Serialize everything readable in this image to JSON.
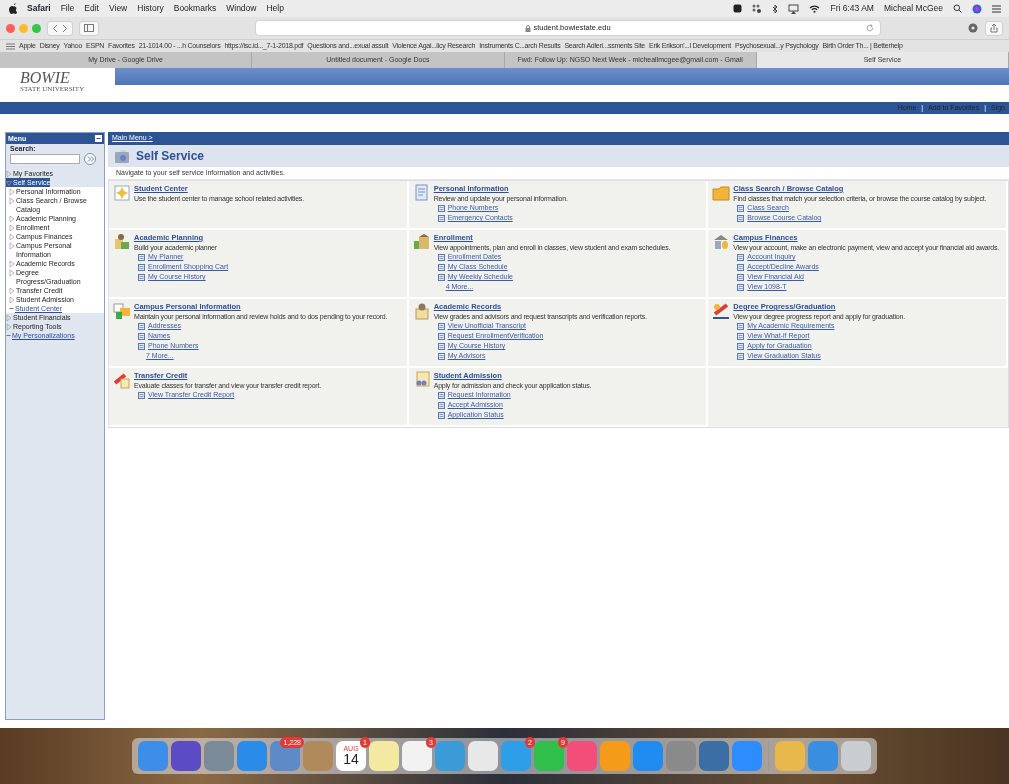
{
  "menubar": {
    "app": "Safari",
    "items": [
      "File",
      "Edit",
      "View",
      "History",
      "Bookmarks",
      "Window",
      "Help"
    ],
    "clock": "Fri 6:43 AM",
    "user": "Micheal McGee"
  },
  "toolbar": {
    "url": "student.bowiestate.edu"
  },
  "bookmarks": [
    "Apple",
    "Disney",
    "Yahoo",
    "ESPN",
    "Favorites",
    "21-1014.00 - ...h Counselors",
    "https://isc.id..._7-1-2018.pdf",
    "Questions and...exual assult",
    "Violence Agai...licy Research",
    "Instruments C...arch Results",
    "Search Adleri...ssments Site",
    "Erik Erikson'...l Development",
    "Psychosexual...y Psychology",
    "Birth Order Th... | Betterhelp"
  ],
  "tabs": [
    {
      "label": "My Drive - Google Drive",
      "selected": false
    },
    {
      "label": "Untitled document - Google Docs",
      "selected": false
    },
    {
      "label": "Fwd: Follow Up: NGSO Next Week - micheallmcgee@gmail.com - Gmail",
      "selected": false
    },
    {
      "label": "Self Service",
      "selected": true
    }
  ],
  "header": {
    "logo": "BOWIE",
    "logo_sub": "STATE UNIVERSITY",
    "links": [
      "Home",
      "|",
      "Add to Favorites",
      "|",
      "Sign"
    ]
  },
  "menu": {
    "title": "Menu",
    "search_label": "Search:",
    "tree": [
      {
        "label": "My Favorites",
        "kind": "folder",
        "expanded": false,
        "selected": false
      },
      {
        "label": "Self Service",
        "kind": "folder",
        "expanded": true,
        "selected": true,
        "children": [
          {
            "label": "Personal Information",
            "kind": "folder",
            "expanded": false,
            "selected": false
          },
          {
            "label": "Class Search / Browse Catalog",
            "kind": "folder",
            "expanded": false,
            "selected": false
          },
          {
            "label": "Academic Planning",
            "kind": "folder",
            "expanded": false,
            "selected": false
          },
          {
            "label": "Enrollment",
            "kind": "folder",
            "expanded": false,
            "selected": false
          },
          {
            "label": "Campus Finances",
            "kind": "folder",
            "expanded": false,
            "selected": false
          },
          {
            "label": "Campus Personal Information",
            "kind": "folder",
            "expanded": false,
            "selected": false
          },
          {
            "label": "Academic Records",
            "kind": "folder",
            "expanded": false,
            "selected": false
          },
          {
            "label": "Degree Progress/Graduation",
            "kind": "folder",
            "expanded": false,
            "selected": false
          },
          {
            "label": "Transfer Credit",
            "kind": "folder",
            "expanded": false,
            "selected": false
          },
          {
            "label": "Student Admission",
            "kind": "folder",
            "expanded": false,
            "selected": false
          },
          {
            "label": "Student Center",
            "kind": "link",
            "selected": false
          }
        ]
      },
      {
        "label": "Student Financials",
        "kind": "folder",
        "expanded": false,
        "selected": false
      },
      {
        "label": "Reporting Tools",
        "kind": "folder",
        "expanded": false,
        "selected": false
      },
      {
        "label": "My Personalizations",
        "kind": "link",
        "selected": false
      }
    ]
  },
  "content": {
    "breadcrumb": "Main Menu >",
    "title": "Self Service",
    "intro": "Navigate to your self service information and activities.",
    "tiles": [
      {
        "title": "Student Center",
        "description": "Use the student center to manage school related activities."
      },
      {
        "title": "Personal Information",
        "description": "Review and update your personal information.",
        "links": [
          "Phone Numbers",
          "Emergency Contacts"
        ]
      },
      {
        "title": "Class Search / Browse Catalog",
        "description": "Find classes that match your selection criteria, or browse the course catalog by subject.",
        "links": [
          "Class Search",
          "Browse Course Catalog"
        ]
      },
      {
        "title": "Academic Planning",
        "description": "Build your academic planner",
        "links": [
          "My Planner",
          "Enrollment Shopping Cart",
          "My Course History"
        ]
      },
      {
        "title": "Enrollment",
        "description": "View appointments, plan and enroll in classes, view student and exam schedules.",
        "links": [
          "Enrollment Dates",
          "My Class Schedule",
          "My Weekly Schedule"
        ],
        "more": "4 More..."
      },
      {
        "title": "Campus Finances",
        "description": "View your account, make an electronic payment, view and accept your financial aid awards.",
        "links": [
          "Account Inquiry",
          "Accept/Decline Awards",
          "View Financial Aid",
          "View 1098-T"
        ]
      },
      {
        "title": "Campus Personal Information",
        "description": "Maintain your personal information and review holds and to dos pending to your record.",
        "links": [
          "Addresses",
          "Names",
          "Phone Numbers"
        ],
        "more": "7 More..."
      },
      {
        "title": "Academic Records",
        "description": "View grades and advisors and request transcripts and verification reports.",
        "links": [
          "View Unofficial Transcript",
          "Request EnrollmentVerification",
          "My Course History",
          "My Advisors"
        ]
      },
      {
        "title": "Degree Progress/Graduation",
        "description": "View your degree progress report and apply for graduation.",
        "links": [
          "My Academic Requirements",
          "View What-if Report",
          "Apply for Graduation",
          "View Graduation Status"
        ]
      },
      {
        "title": "Transfer Credit",
        "description": "Evaluate classes for transfer and view your transfer credit report.",
        "links": [
          "View Transfer Credit Report"
        ]
      },
      {
        "title": "Student Admission",
        "description": "Apply for admission and check your application status.",
        "links": [
          "Request Information",
          "Accept Admission",
          "Application Status"
        ]
      }
    ]
  },
  "dock": [
    {
      "kind": "app",
      "color": "#3c8ee8"
    },
    {
      "kind": "app",
      "color": "#5b4bc4"
    },
    {
      "kind": "app",
      "color": "#7a8a99"
    },
    {
      "kind": "app",
      "color": "#2a8be8"
    },
    {
      "kind": "app",
      "color": "#5e8ac8",
      "badge": "1,228"
    },
    {
      "kind": "app",
      "color": "#b08a5a"
    },
    {
      "kind": "calendar",
      "color": "#ffffff",
      "month": "AUG",
      "day": "14",
      "badge": "1"
    },
    {
      "kind": "app",
      "color": "#f4e9a0"
    },
    {
      "kind": "app",
      "color": "#f2f2f2",
      "badge": "3"
    },
    {
      "kind": "app",
      "color": "#3a9bd8"
    },
    {
      "kind": "app",
      "color": "#e8e8e8"
    },
    {
      "kind": "app",
      "color": "#2f9ee8",
      "badge": "2"
    },
    {
      "kind": "app",
      "color": "#2fbf4a",
      "badge": "9"
    },
    {
      "kind": "app",
      "color": "#f34d7a"
    },
    {
      "kind": "app",
      "color": "#f59b1a"
    },
    {
      "kind": "app",
      "color": "#1e8cf0"
    },
    {
      "kind": "app",
      "color": "#8a8a8a"
    },
    {
      "kind": "app",
      "color": "#3a6ea5"
    },
    {
      "kind": "app",
      "color": "#2d8cff"
    },
    {
      "kind": "separator"
    },
    {
      "kind": "app",
      "color": "#e9b84a"
    },
    {
      "kind": "app",
      "color": "#3a8ee0"
    },
    {
      "kind": "app",
      "color": "#c9ccd0"
    }
  ]
}
